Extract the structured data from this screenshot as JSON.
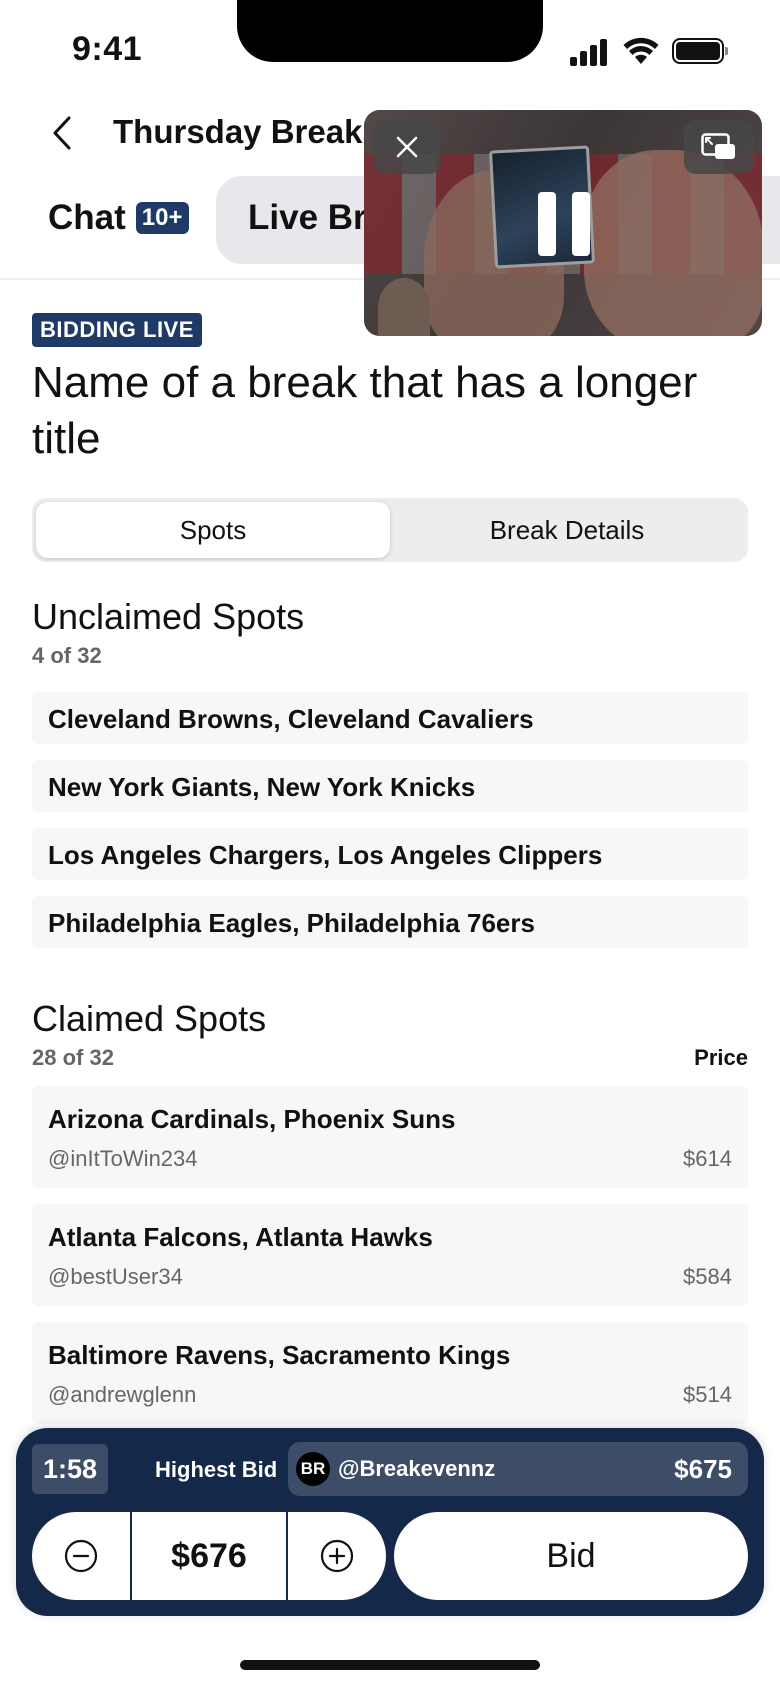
{
  "status_bar": {
    "time": "9:41"
  },
  "nav": {
    "title": "Thursday Breaks"
  },
  "tabs": {
    "chat_label": "Chat",
    "chat_badge": "10+",
    "live_label": "Live Break"
  },
  "live_badge": "BIDDING LIVE",
  "page_title": "Name of a break that has a longer title",
  "segmented": {
    "spots": "Spots",
    "details": "Break Details"
  },
  "unclaimed": {
    "title": "Unclaimed Spots",
    "count": "4 of 32",
    "items": [
      "Cleveland Browns, Cleveland Cavaliers",
      "New York Giants, New York Knicks",
      "Los Angeles Chargers, Los Angeles Clippers",
      "Philadelphia Eagles, Philadelphia 76ers"
    ]
  },
  "claimed": {
    "title": "Claimed Spots",
    "count": "28 of 32",
    "price_header": "Price",
    "items": [
      {
        "name": "Arizona Cardinals, Phoenix Suns",
        "user": "@inItToWin234",
        "price": "$614"
      },
      {
        "name": "Atlanta Falcons, Atlanta Hawks",
        "user": "@bestUser34",
        "price": "$584"
      },
      {
        "name": "Baltimore Ravens, Sacramento Kings",
        "user": "@andrewglenn",
        "price": "$514"
      }
    ]
  },
  "bid_panel": {
    "timer": "1:58",
    "highest_label": "Highest Bid",
    "avatar_initials": "BR",
    "bidder": "@Breakevennz",
    "highest_amount": "$675",
    "bid_value": "$676",
    "bid_label": "Bid"
  },
  "icons": {
    "back": "chevron-left-icon",
    "close": "close-icon",
    "expand": "picture-in-picture-icon",
    "pause": "pause-icon",
    "minus": "minus-circle-icon",
    "plus": "plus-circle-icon"
  },
  "colors": {
    "brand_navy": "#14284a",
    "badge_navy": "#1f3a66"
  }
}
